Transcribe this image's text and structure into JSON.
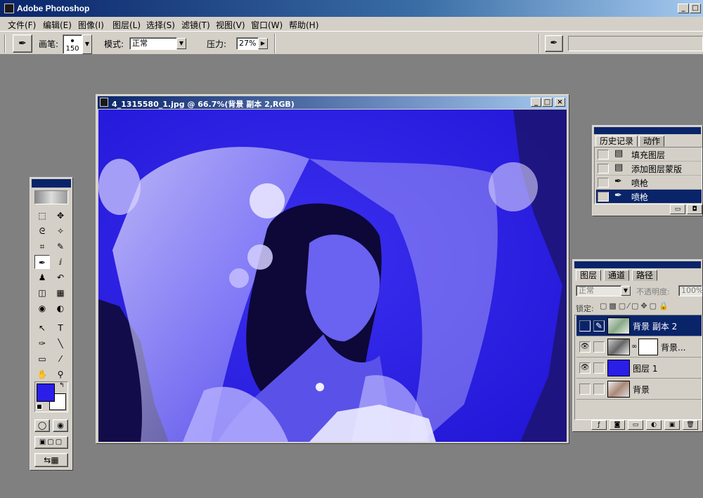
{
  "app": {
    "title": "Adobe Photoshop",
    "min": "_",
    "max": "□"
  },
  "menu": [
    "文件(F)",
    "编辑(E)",
    "图像(I)",
    "图层(L)",
    "选择(S)",
    "滤镜(T)",
    "视图(V)",
    "窗口(W)",
    "帮助(H)"
  ],
  "options": {
    "brush_label": "画笔:",
    "brush_size": "150",
    "mode_label": "模式:",
    "mode_value": "正常",
    "pressure_label": "压力:",
    "pressure_value": "27%"
  },
  "document": {
    "title": "4_1315580_1.jpg @ 66.7%(背景 副本 2,RGB)",
    "min": "_",
    "max": "□",
    "close": "×"
  },
  "toolbox": {
    "tools": [
      {
        "name": "marquee-tool-icon",
        "glyph": "⬚"
      },
      {
        "name": "move-tool-icon",
        "glyph": "✥"
      },
      {
        "name": "lasso-tool-icon",
        "glyph": "ᘓ"
      },
      {
        "name": "magic-wand-tool-icon",
        "glyph": "✧"
      },
      {
        "name": "crop-tool-icon",
        "glyph": "⌗"
      },
      {
        "name": "slice-tool-icon",
        "glyph": "✎"
      },
      {
        "name": "airbrush-tool-icon",
        "glyph": "✒"
      },
      {
        "name": "paintbrush-tool-icon",
        "glyph": "ⅈ"
      },
      {
        "name": "rubber-stamp-tool-icon",
        "glyph": "♟"
      },
      {
        "name": "history-brush-tool-icon",
        "glyph": "↶"
      },
      {
        "name": "eraser-tool-icon",
        "glyph": "◫"
      },
      {
        "name": "gradient-tool-icon",
        "glyph": "▦"
      },
      {
        "name": "blur-tool-icon",
        "glyph": "◉"
      },
      {
        "name": "dodge-tool-icon",
        "glyph": "◐"
      },
      {
        "name": "path-select-tool-icon",
        "glyph": "↖"
      },
      {
        "name": "type-tool-icon",
        "glyph": "T"
      },
      {
        "name": "pen-tool-icon",
        "glyph": "✑"
      },
      {
        "name": "line-tool-icon",
        "glyph": "╲"
      },
      {
        "name": "notes-tool-icon",
        "glyph": "▭"
      },
      {
        "name": "eyedropper-tool-icon",
        "glyph": "⁄"
      },
      {
        "name": "hand-tool-icon",
        "glyph": "✋"
      },
      {
        "name": "zoom-tool-icon",
        "glyph": "⚲"
      }
    ],
    "foreground_color": "#2a1ee8",
    "background_color": "#ffffff"
  },
  "history": {
    "tabs": [
      "历史记录",
      "动作"
    ],
    "items": [
      {
        "label": "填充图层",
        "icon": "document-icon"
      },
      {
        "label": "添加图层蒙版",
        "icon": "document-icon"
      },
      {
        "label": "喷枪",
        "icon": "airbrush-icon"
      },
      {
        "label": "喷枪",
        "icon": "airbrush-icon"
      }
    ]
  },
  "layers": {
    "tabs": [
      "图层",
      "通道",
      "路径"
    ],
    "blend_mode": "正常",
    "opacity_label": "不透明度:",
    "opacity_value": "100%",
    "lock_label": "锁定:",
    "items": [
      {
        "name": "背景 副本 2",
        "visible": false,
        "selected": true
      },
      {
        "name": "背景...",
        "visible": true,
        "selected": false
      },
      {
        "name": "图层 1",
        "visible": true,
        "selected": false
      },
      {
        "name": "背景",
        "visible": false,
        "selected": false
      }
    ]
  },
  "colors": {
    "accent": "#0a246a",
    "canvas_blue": "#2a1ee8",
    "chrome": "#d4d0c8"
  }
}
